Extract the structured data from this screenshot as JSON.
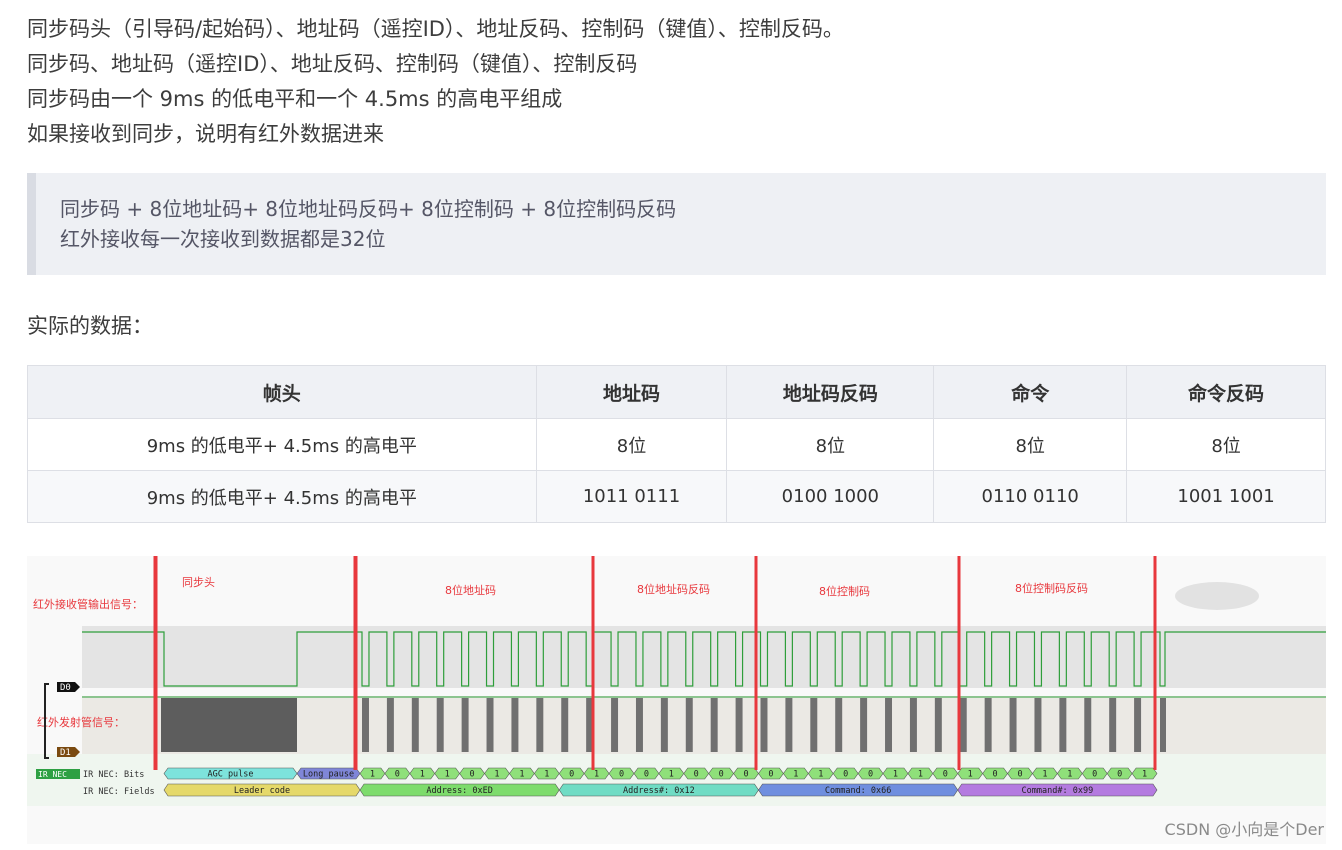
{
  "paragraphs": [
    "同步码头（引导码/起始码）、地址码（遥控ID）、地址反码、控制码（键值）、控制反码。",
    "同步码、地址码（遥控ID）、地址反码、控制码（键值）、控制反码",
    "同步码由一个 9ms 的低电平和一个 4.5ms 的高电平组成",
    "如果接收到同步，说明有红外数据进来"
  ],
  "quote": {
    "line1": "同步码 + 8位地址码+ 8位地址码反码+ 8位控制码 + 8位控制码反码",
    "line2": "红外接收每一次接收到数据都是32位"
  },
  "section_label": "实际的数据：",
  "table": {
    "headers": [
      "帧头",
      "地址码",
      "地址码反码",
      "命令",
      "命令反码"
    ],
    "rows": [
      [
        "9ms 的低电平+ 4.5ms 的高电平",
        "8位",
        "8位",
        "8位",
        "8位"
      ],
      [
        "9ms 的低电平+ 4.5ms 的高电平",
        "1011 0111",
        "0100 1000",
        "0110 0110",
        "1001 1001"
      ]
    ]
  },
  "waveform": {
    "labels": {
      "receiver": "红外接收管输出信号：",
      "transmitter": "红外发射管信号：",
      "ch_d0": "D0",
      "ch_d1": "D1",
      "ir_nec": "IR NEC",
      "row_bits": "IR NEC: Bits",
      "row_fields": "IR NEC: Fields"
    },
    "annotations": [
      "同步头",
      "8位地址码",
      "8位地址码反码",
      "8位控制码",
      "8位控制码反码"
    ],
    "bits_row": {
      "agc": "AGC pulse",
      "long_pause": "Long pause",
      "bits": [
        "1",
        "0",
        "1",
        "1",
        "0",
        "1",
        "1",
        "1",
        "0",
        "1",
        "0",
        "0",
        "1",
        "0",
        "0",
        "0",
        "0",
        "1",
        "1",
        "0",
        "0",
        "1",
        "1",
        "0",
        "1",
        "0",
        "0",
        "1",
        "1",
        "0",
        "0",
        "1"
      ]
    },
    "fields_row": [
      "Leader code",
      "Address: 0xED",
      "Address#: 0x12",
      "Command: 0x66",
      "Command#: 0x99"
    ],
    "colors": {
      "marker": "#e8383d",
      "signal": "#2e9e3a",
      "agc": "#7de3dc",
      "long_pause": "#7f86d8",
      "bit": "#8fe07a",
      "leader": "#e5d96a",
      "address": "#7ddc6c",
      "address_inv": "#6fdcc4",
      "command": "#6f8fdf",
      "command_inv": "#b47be0"
    }
  },
  "watermark": "CSDN @小向是个Der"
}
